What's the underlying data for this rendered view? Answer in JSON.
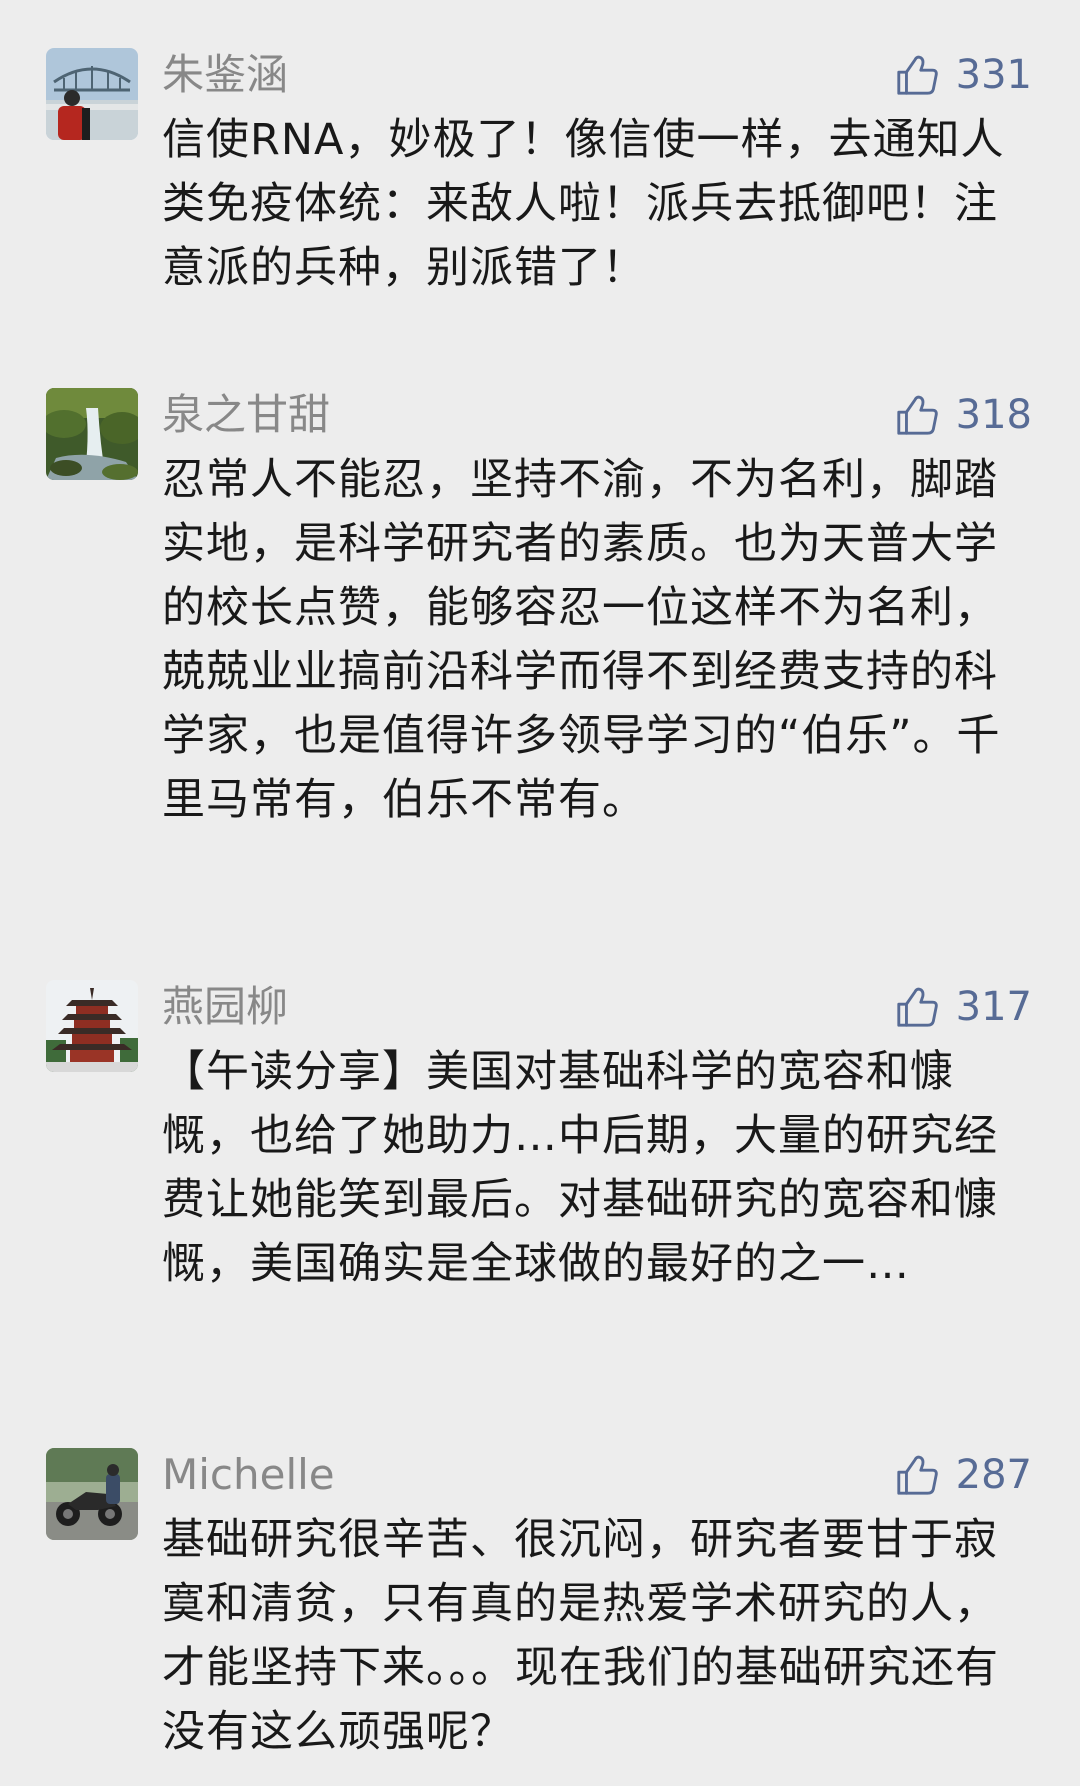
{
  "comments": [
    {
      "author": "朱鉴涵",
      "likes": "331",
      "avatar_icon": "avatar-bridge-photo-icon",
      "text": "信使RNA，妙极了！像信使一样，去通知人类免疫体统：来敌人啦！派兵去抵御吧！注意派的兵种，别派错了！"
    },
    {
      "author": "泉之甘甜",
      "likes": "318",
      "avatar_icon": "avatar-waterfall-photo-icon",
      "text": "忍常人不能忍，坚持不渝，不为名利，脚踏实地，是科学研究者的素质。也为天普大学的校长点赞，能够容忍一位这样不为名利，兢兢业业搞前沿科学而得不到经费支持的科学家，也是值得许多领导学习的“伯乐”。千里马常有，伯乐不常有。"
    },
    {
      "author": "燕园柳",
      "likes": "317",
      "avatar_icon": "avatar-pagoda-photo-icon",
      "text": "【午读分享】美国对基础科学的宽容和慷慨，也给了她助力…中后期，大量的研究经费让她能笑到最后。对基础研究的宽容和慷慨，美国确实是全球做的最好的之一…"
    },
    {
      "author": "Michelle",
      "likes": "287",
      "avatar_icon": "avatar-motorcycle-photo-icon",
      "text": "基础研究很辛苦、很沉闷，研究者要甘于寂寞和清贫，只有真的是热爱学术研究的人，才能坚持下来。。。现在我们的基础研究还有没有这么顽强呢？"
    }
  ],
  "colors": {
    "background": "#EDEDED",
    "author_name": "#888888",
    "like_accent": "#576B95",
    "body_text": "#191919"
  },
  "icons": {
    "like": "thumbs-up-icon"
  }
}
